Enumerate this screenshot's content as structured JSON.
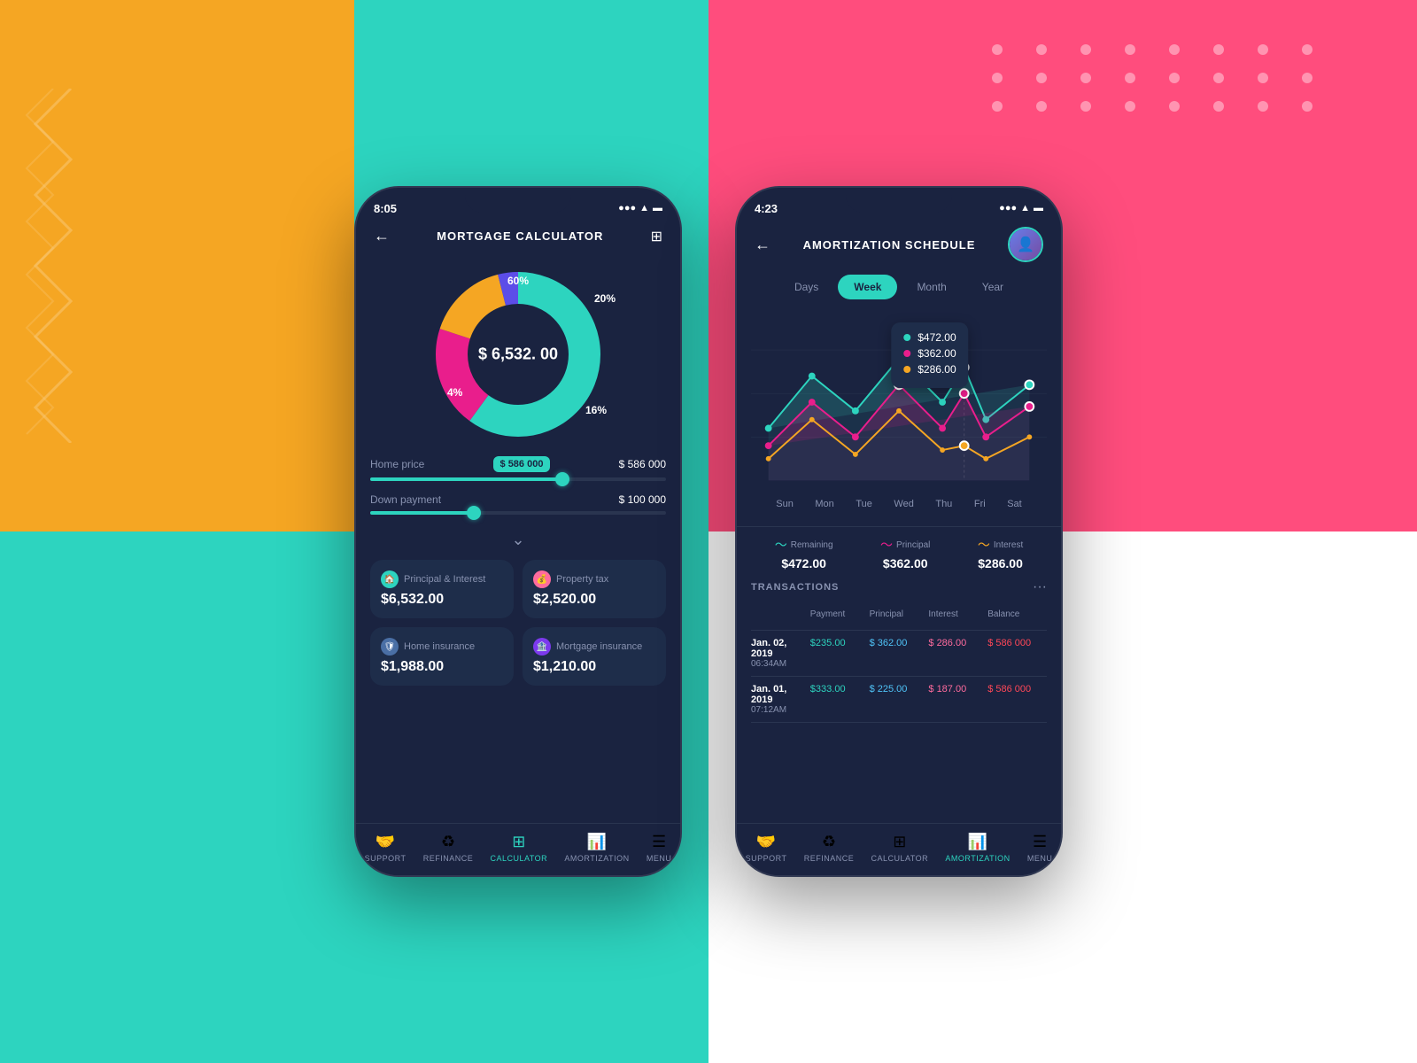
{
  "backgrounds": {
    "colors": {
      "orange": "#F5A623",
      "pink": "#FF4D7D",
      "teal": "#2DD4BF",
      "dark": "#1a2340"
    }
  },
  "phone1": {
    "status": {
      "time": "8:05",
      "icons": "●●● ▲ ▬"
    },
    "header": {
      "title": "MORTGAGE CALCULATOR",
      "back": "←",
      "filter": "⊞"
    },
    "donut": {
      "center_amount": "$ 6,532. 00",
      "segments": [
        {
          "label": "60%",
          "color": "#2dd4bf",
          "value": 60
        },
        {
          "label": "20%",
          "color": "#e91e8c",
          "value": 20
        },
        {
          "label": "16%",
          "color": "#f5a623",
          "value": 16
        },
        {
          "label": "4%",
          "color": "#5c4de8",
          "value": 4
        }
      ]
    },
    "home_price": {
      "label": "Home price",
      "badge": "$ 586 000",
      "value": "$ 586 000",
      "slider_pct": 65
    },
    "down_payment": {
      "label": "Down payment",
      "value": "$ 100 000",
      "slider_pct": 35
    },
    "cards": [
      {
        "label": "Principal & Interest",
        "value": "$6,532.00",
        "icon_type": "teal"
      },
      {
        "label": "Property tax",
        "value": "$2,520.00",
        "icon_type": "pink"
      },
      {
        "label": "Home insurance",
        "value": "$1,988.00",
        "icon_type": "blue"
      },
      {
        "label": "Mortgage insurance",
        "value": "$1,210.00",
        "icon_type": "purple"
      }
    ],
    "nav": [
      {
        "label": "SUPPORT",
        "active": false
      },
      {
        "label": "REFINaNce",
        "active": false
      },
      {
        "label": "CALCULATOR",
        "active": true
      },
      {
        "label": "AMORTIZATION",
        "active": false
      },
      {
        "label": "MENU",
        "active": false
      }
    ]
  },
  "phone2": {
    "status": {
      "time": "4:23",
      "icons": "●●● ▲ ▬"
    },
    "header": {
      "title": "AMORTIZATION SCHEDULE",
      "back": "←"
    },
    "tabs": [
      {
        "label": "Days",
        "active": false
      },
      {
        "label": "Week",
        "active": true
      },
      {
        "label": "Month",
        "active": false
      },
      {
        "label": "Year",
        "active": false
      }
    ],
    "chart": {
      "days": [
        "Sun",
        "Mon",
        "Tue",
        "Wed",
        "Thu",
        "Fri",
        "Sat"
      ],
      "tooltip": {
        "values": [
          {
            "color": "#2dd4bf",
            "amount": "$472.00"
          },
          {
            "color": "#e91e8c",
            "amount": "$362.00"
          },
          {
            "color": "#f5a623",
            "amount": "$286.00"
          }
        ]
      }
    },
    "legend": [
      {
        "label": "Remaining",
        "color": "#2dd4bf",
        "value": "$472.00"
      },
      {
        "label": "Principal",
        "color": "#e91e8c",
        "value": "$362.00"
      },
      {
        "label": "Interest",
        "color": "#f5a623",
        "value": "$286.00"
      }
    ],
    "transactions": {
      "title": "TRANSACTIONS",
      "rows": [
        {
          "date": "Jan. 02, 2019",
          "time": "06:34AM",
          "payment": "$235.00",
          "principal": "$ 362.00",
          "interest": "$ 286.00",
          "balance": "$ 586 000"
        },
        {
          "date": "Jan. 01, 2019",
          "time": "07:12AM",
          "payment": "$333.00",
          "principal": "$ 225.00",
          "interest": "$ 187.00",
          "balance": "$ 586 000"
        }
      ]
    },
    "nav": [
      {
        "label": "SUPPORT",
        "active": false
      },
      {
        "label": "REFINaNce",
        "active": false
      },
      {
        "label": "CALCULATOR",
        "active": false
      },
      {
        "label": "AMORTIZATION",
        "active": true
      },
      {
        "label": "MENU",
        "active": false
      }
    ]
  }
}
